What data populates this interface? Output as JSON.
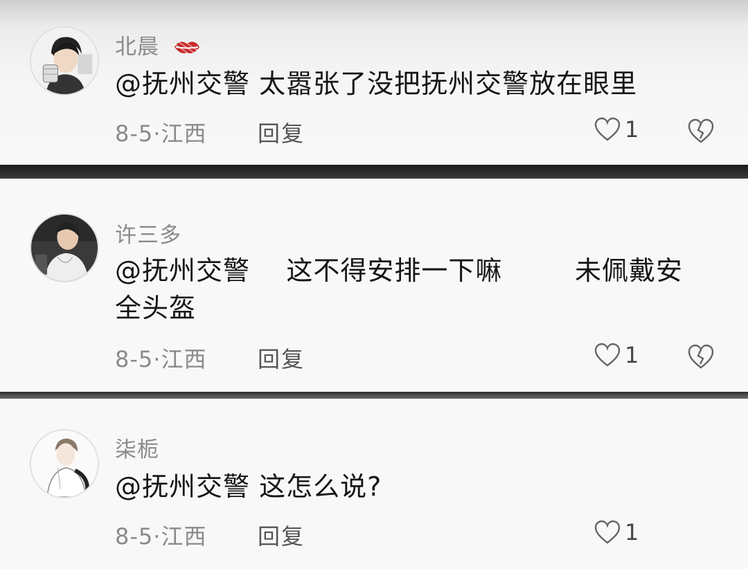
{
  "comments": [
    {
      "username": "北晨",
      "mention": "@抚州交警",
      "text_line1": " 太嚣张了没把抚州交警放在眼里",
      "text_line2": "",
      "date": "8-5",
      "region": "江西",
      "reply_label": "回复",
      "likes": "1",
      "has_badge": true
    },
    {
      "username": "许三多",
      "mention": "@抚州交警",
      "text_line1": "    这不得安排一下嘛        未佩戴安",
      "text_line2": "全头盔",
      "date": "8-5",
      "region": "江西",
      "reply_label": "回复",
      "likes": "1",
      "has_badge": false
    },
    {
      "username": "柒栀",
      "mention": "@抚州交警",
      "text_line1": " 这怎么说?",
      "text_line2": "",
      "date": "8-5",
      "region": "江西",
      "reply_label": "回复",
      "likes": "1",
      "has_badge": false
    }
  ],
  "meta_separator": "·",
  "icons": {
    "badge": "lips-icon",
    "like": "heart-outline-icon",
    "dislike": "broken-heart-icon"
  },
  "colors": {
    "username": "#8a8a8a",
    "text": "#161616",
    "badge": "#d23030"
  }
}
